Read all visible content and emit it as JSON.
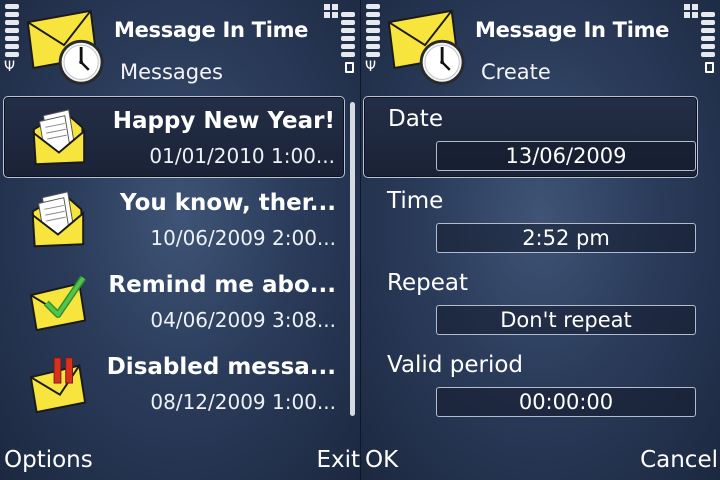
{
  "left_screen": {
    "title": "Message In Time",
    "subtitle": "Messages",
    "messages": [
      {
        "title": "Happy New Year!",
        "date": "01/01/2010 1:00...",
        "icon": "envelope-document-icon",
        "selected": true
      },
      {
        "title": "You know, ther...",
        "date": "10/06/2009 2:00...",
        "icon": "envelope-document-icon",
        "selected": false
      },
      {
        "title": "Remind me abo...",
        "date": "04/06/2009 3:08...",
        "icon": "envelope-checkmark-icon",
        "selected": false
      },
      {
        "title": "Disabled messa...",
        "date": "08/12/2009 1:00...",
        "icon": "envelope-paused-icon",
        "selected": false
      }
    ],
    "softkeys": {
      "left": "Options",
      "right": "Exit"
    }
  },
  "right_screen": {
    "title": "Message In Time",
    "subtitle": "Create",
    "fields": [
      {
        "label": "Date",
        "value": "13/06/2009",
        "selected": true
      },
      {
        "label": "Time",
        "value": "2:52 pm",
        "selected": false
      },
      {
        "label": "Repeat",
        "value": "Don't repeat",
        "selected": false
      },
      {
        "label": "Valid period",
        "value": "00:00:00",
        "selected": false
      }
    ],
    "softkeys": {
      "left": "OK",
      "right": "Cancel"
    }
  },
  "colors": {
    "background": "#2b3c5b",
    "envelope": "#f5e23a",
    "checkmark": "#3aa23a",
    "pause": "#d8321f"
  }
}
